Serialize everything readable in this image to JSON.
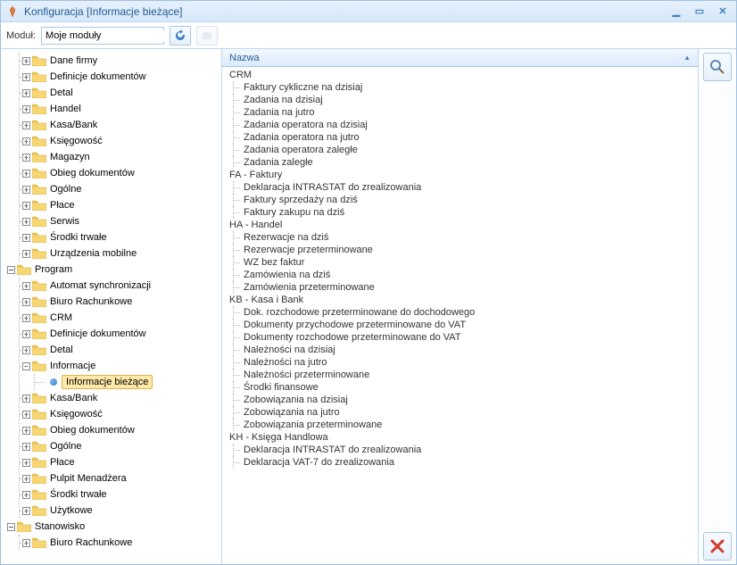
{
  "window": {
    "title": "Konfiguracja [Informacje bieżące]"
  },
  "toolbar": {
    "module_label": "Moduł:",
    "module_value": "Moje moduły"
  },
  "list": {
    "column": "Nazwa",
    "groups": [
      {
        "name": "CRM",
        "items": [
          "Faktury cykliczne na dzisiaj",
          "Zadania na dzisiaj",
          "Zadania na jutro",
          "Zadania operatora na dzisiaj",
          "Zadania operatora na jutro",
          "Zadania operatora zaległe",
          "Zadania zaległe"
        ]
      },
      {
        "name": "FA - Faktury",
        "items": [
          "Deklaracja INTRASTAT do zrealizowania",
          "Faktury sprzedaży na dziś",
          "Faktury zakupu na dziś"
        ]
      },
      {
        "name": "HA - Handel",
        "items": [
          "Rezerwacje na dziś",
          "Rezerwacje przeterminowane",
          "WZ bez faktur",
          "Zamówienia na dziś",
          "Zamówienia przeterminowane"
        ]
      },
      {
        "name": "KB - Kasa i Bank",
        "items": [
          "Dok. rozchodowe przeterminowane do dochodowego",
          "Dokumenty przychodowe przeterminowane do VAT",
          "Dokumenty rozchodowe przeterminowane do VAT",
          "Należności na dzisiaj",
          "Należności na jutro",
          "Należności przeterminowane",
          "Środki finansowe",
          "Zobowiązania na dzisiaj",
          "Zobowiązania na jutro",
          "Zobowiązania przeterminowane"
        ]
      },
      {
        "name": "KH - Księga Handlowa",
        "items": [
          "Deklaracja INTRASTAT do zrealizowania",
          "Deklaracja VAT-7 do zrealizowania"
        ]
      }
    ]
  },
  "tree": {
    "firma_children": [
      "Dane firmy",
      "Definicje dokumentów",
      "Detal",
      "Handel",
      "Kasa/Bank",
      "Księgowość",
      "Magazyn",
      "Obieg dokumentów",
      "Ogólne",
      "Płace",
      "Serwis",
      "Środki trwałe",
      "Urządzenia mobilne"
    ],
    "program_label": "Program",
    "program_children_before": [
      "Automat synchronizacji",
      "Biuro Rachunkowe",
      "CRM",
      "Definicje dokumentów",
      "Detal"
    ],
    "informacje_label": "Informacje",
    "informacje_biezace": "Informacje bieżące",
    "program_children_after": [
      "Kasa/Bank",
      "Księgowość",
      "Obieg dokumentów",
      "Ogólne",
      "Płace",
      "Pulpit Menadżera",
      "Środki trwałe",
      "Użytkowe"
    ],
    "stanowisko_label": "Stanowisko",
    "stanowisko_children": [
      "Biuro Rachunkowe"
    ]
  }
}
